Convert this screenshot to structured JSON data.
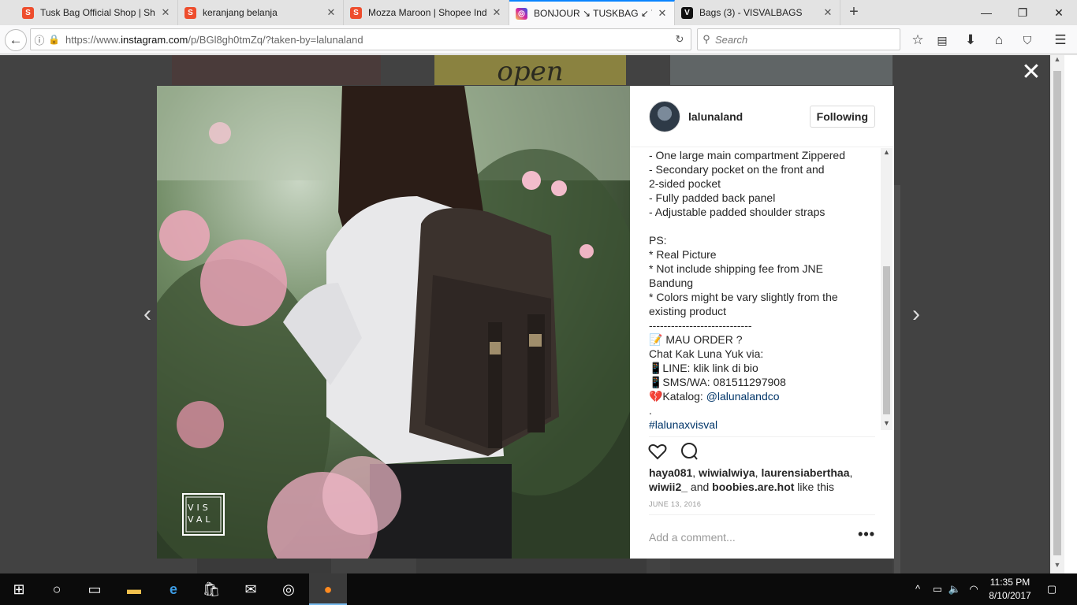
{
  "browser": {
    "tabs": [
      {
        "title": "Tusk Bag Official Shop | Sho",
        "favicon": "shopee-icon",
        "active": false
      },
      {
        "title": "keranjang belanja",
        "favicon": "shopee-icon",
        "active": false
      },
      {
        "title": "Mozza Maroon | Shopee Indo",
        "favicon": "shopee-icon",
        "active": false
      },
      {
        "title": "BONJOUR ↘ TUSKBAG ↙ VIS",
        "favicon": "instagram-icon",
        "active": true
      },
      {
        "title": "Bags (3) - VISVALBAGS",
        "favicon": "visval-icon",
        "active": false
      }
    ],
    "url_prefix": "https://www.",
    "url_domain": "instagram.com",
    "url_rest": "/p/BGl8gh0tmZq/?taken-by=lalunaland",
    "search_placeholder": "Search"
  },
  "background": {
    "peek_text": "open"
  },
  "post": {
    "username": "lalunaland",
    "follow_label": "Following",
    "photo_watermark": "VISVAL",
    "caption_lines": [
      "- One large main compartment Zippered",
      "- Secondary pocket on the front and",
      "2-sided pocket",
      "- Fully padded back panel",
      "- Adjustable padded shoulder straps",
      "",
      "PS:",
      "* Real Picture",
      "* Not include shipping fee from JNE",
      "Bandung",
      "* Colors might be vary slightly from the",
      "existing product",
      "----------------------------",
      "📝 MAU ORDER ?",
      "Chat Kak Luna Yuk via:",
      "📱LINE: klik link di bio",
      "📱SMS/WA: 081511297908",
      "💔Katalog: ",
      ".",
      ""
    ],
    "katalog_link": "@lalunaland",
    "katalog_suffix": "co",
    "hashtag": "#lalunaxvisval",
    "likes": {
      "user1": "haya081",
      "user2": "wiwialwiya",
      "user3": "laurensiaberthaa",
      "user4": "wiwii2_",
      "user5": "boobies.are.hot",
      "and": " and ",
      "suffix": " like this"
    },
    "date": "JUNE 13, 2016",
    "comment_placeholder": "Add a comment...",
    "more_label": "•••"
  },
  "taskbar": {
    "time": "11:35 PM",
    "date": "8/10/2017"
  }
}
